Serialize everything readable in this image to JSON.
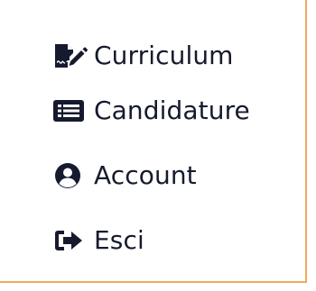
{
  "menu": {
    "items": [
      {
        "label": "Curriculum",
        "icon": "file-signature-icon"
      },
      {
        "label": "Candidature",
        "icon": "list-alt-icon"
      },
      {
        "label": "Account",
        "icon": "user-circle-icon"
      },
      {
        "label": "Esci",
        "icon": "sign-out-icon"
      }
    ]
  },
  "colors": {
    "text": "#161a2e",
    "border_accent": "#f0a85a",
    "background": "#ffffff"
  }
}
